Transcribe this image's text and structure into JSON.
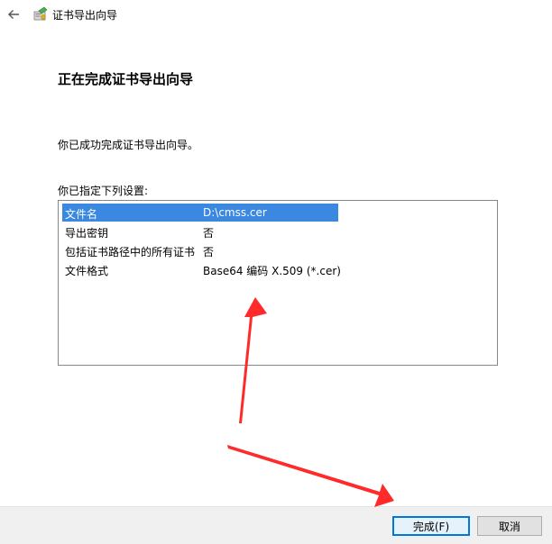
{
  "window": {
    "title": "证书导出向导"
  },
  "main": {
    "heading": "正在完成证书导出向导",
    "message": "你已成功完成证书导出向导。",
    "list_label": "你已指定下列设置:",
    "settings": [
      {
        "key": "文件名",
        "value": "D:\\cmss.cer"
      },
      {
        "key": "导出密钥",
        "value": "否"
      },
      {
        "key": "包括证书路径中的所有证书",
        "value": "否"
      },
      {
        "key": "文件格式",
        "value": "Base64 编码 X.509 (*.cer)"
      }
    ],
    "selected_index": 0
  },
  "footer": {
    "finish_label": "完成(F)",
    "cancel_label": "取消"
  },
  "colors": {
    "selection": "#3a88e0",
    "primary_border": "#0078d7",
    "annotation_arrow": "#ff2a2a"
  }
}
